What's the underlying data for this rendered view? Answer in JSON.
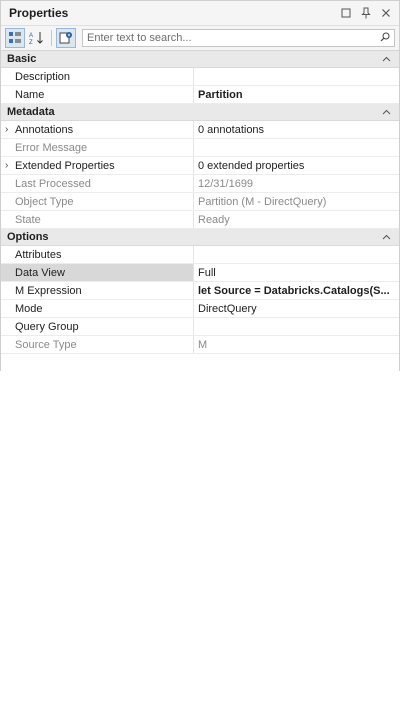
{
  "panel": {
    "title": "Properties"
  },
  "search": {
    "placeholder": "Enter text to search..."
  },
  "categories": [
    {
      "label": "Basic",
      "rows": [
        {
          "name": "Description",
          "value": ""
        },
        {
          "name": "Name",
          "value": "Partition",
          "bold": true
        }
      ]
    },
    {
      "label": "Metadata",
      "rows": [
        {
          "name": "Annotations",
          "value": "0 annotations",
          "expandable": true
        },
        {
          "name": "Error Message",
          "value": "",
          "readonly": true
        },
        {
          "name": "Extended Properties",
          "value": "0 extended properties",
          "expandable": true
        },
        {
          "name": "Last Processed",
          "value": "12/31/1699",
          "readonly": true
        },
        {
          "name": "Object Type",
          "value": "Partition (M - DirectQuery)",
          "readonly": true
        },
        {
          "name": "State",
          "value": "Ready",
          "readonly": true
        }
      ]
    },
    {
      "label": "Options",
      "rows": [
        {
          "name": "Attributes",
          "value": ""
        },
        {
          "name": "Data View",
          "value": "Full",
          "selected": true
        },
        {
          "name": "M Expression",
          "value": "let    Source = Databricks.Catalogs(S...",
          "bold": true
        },
        {
          "name": "Mode",
          "value": "DirectQuery"
        },
        {
          "name": "Query Group",
          "value": ""
        },
        {
          "name": "Source Type",
          "value": "M",
          "readonly": true
        }
      ]
    }
  ]
}
